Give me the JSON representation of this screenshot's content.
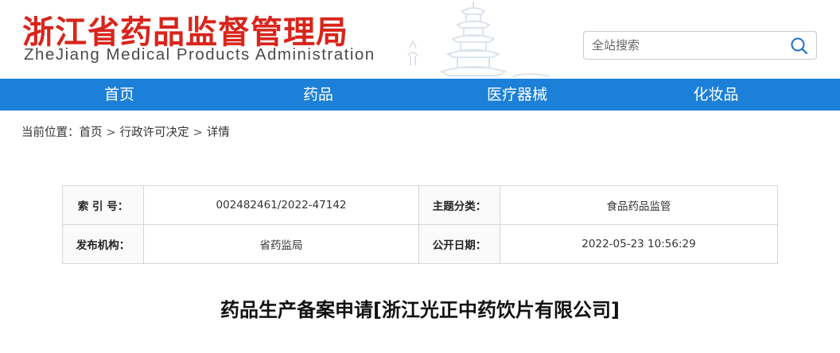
{
  "header": {
    "title": "浙江省药品监督管理局",
    "subtitle": "ZheJiang Medical Products Administration",
    "search": {
      "placeholder": "全站搜索",
      "value": ""
    }
  },
  "nav": {
    "items": [
      {
        "label": "首页"
      },
      {
        "label": "药品"
      },
      {
        "label": "医疗器械"
      },
      {
        "label": "化妆品"
      }
    ]
  },
  "breadcrumb": {
    "prefix": "当前位置：",
    "items": [
      "首页",
      "行政许可决定",
      "详情"
    ],
    "separator": ">"
  },
  "info": {
    "index_label": "索 引 号：",
    "index_value": "002482461/2022-47142",
    "topic_label": "主题分类：",
    "topic_value": "食品药品监管",
    "publisher_label": "发布机构：",
    "publisher_value": "省药监局",
    "date_label": "公开日期：",
    "date_value": "2022-05-23 10:56:29"
  },
  "article": {
    "title": "药品生产备案申请[浙江光正中药饮片有限公司]"
  },
  "colors": {
    "brand_red": "#d8251c",
    "nav_blue": "#1c80d8"
  },
  "icons": {
    "search": "search-icon",
    "pagoda": "pagoda-watermark-icon"
  }
}
